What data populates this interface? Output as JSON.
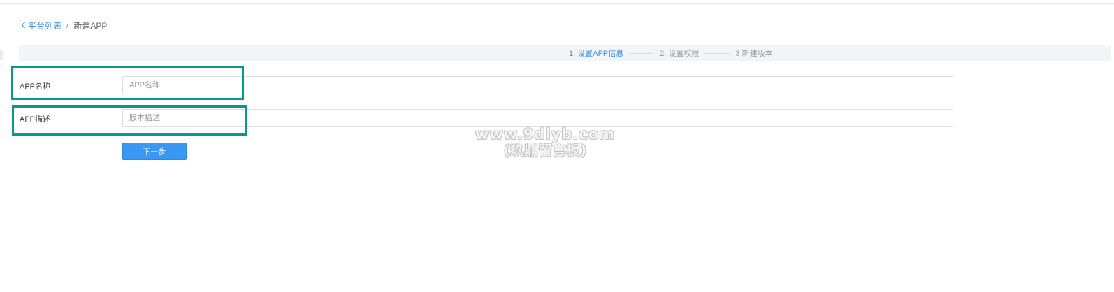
{
  "breadcrumb": {
    "back_label": "平台列表",
    "separator": "/",
    "current": "新建APP"
  },
  "steps": [
    {
      "label": "1. 设置APP信息",
      "active": true
    },
    {
      "label": "2. 设置权限",
      "active": false
    },
    {
      "label": "3 新建版本",
      "active": false
    }
  ],
  "form": {
    "name": {
      "label": "APP名称",
      "placeholder": "APP名称",
      "value": ""
    },
    "description": {
      "label": "APP描述",
      "placeholder": "版本描述",
      "value": ""
    }
  },
  "actions": {
    "next_label": "下一步"
  },
  "watermark": {
    "line1": "www.9dlyb.com",
    "line2": "(玖鼎留言板)"
  },
  "colors": {
    "accent": "#3a8ee6",
    "button": "#3a98f5",
    "highlight_box": "#0c9690",
    "steps_bar": "#f2f4f7"
  },
  "icons": {
    "back": "chevron-left-icon"
  }
}
